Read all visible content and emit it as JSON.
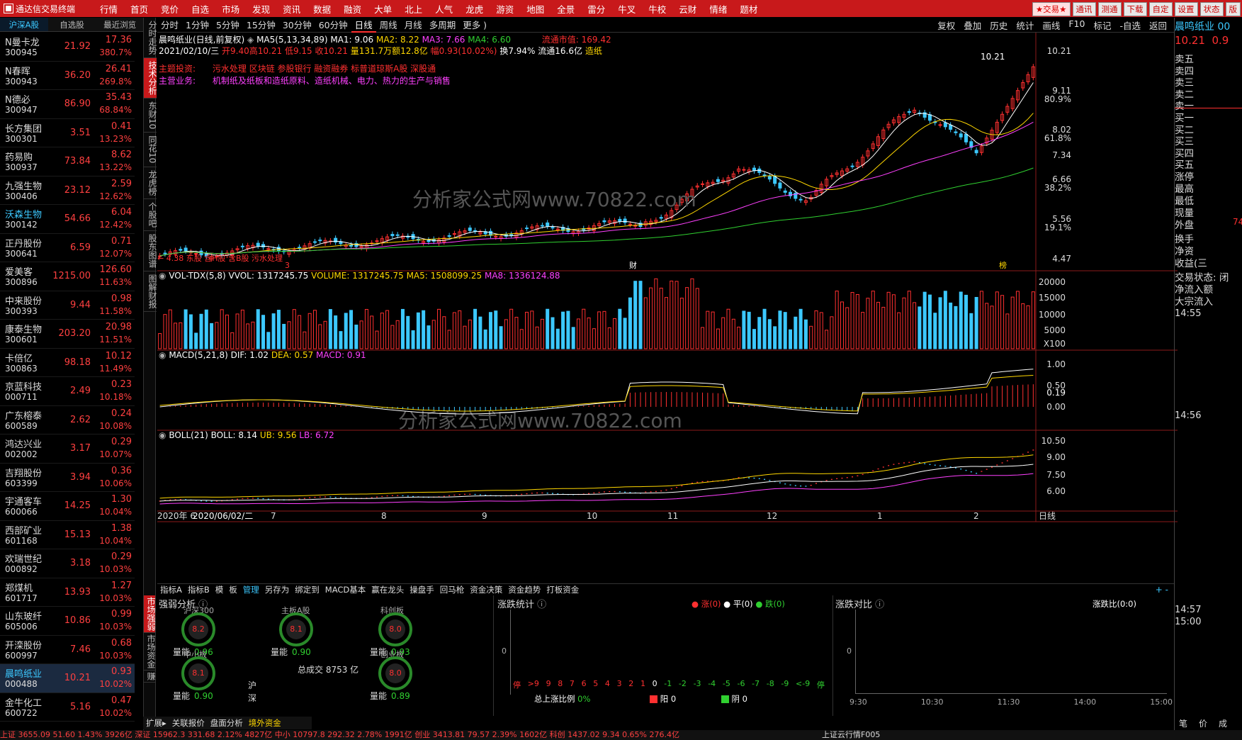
{
  "app": {
    "title": "通达信交易终端"
  },
  "menu": [
    "行情",
    "首页",
    "竞价",
    "自选",
    "市场",
    "发现",
    "资讯",
    "数据",
    "融资",
    "大单",
    "北上",
    "人气",
    "龙虎",
    "游资",
    "地图",
    "全景",
    "雷分",
    "牛叉",
    "牛校",
    "云财",
    "情绪",
    "题材"
  ],
  "menu_right": [
    "★交易★",
    "通讯",
    "测通",
    "下载",
    "自定",
    "设置",
    "状态",
    "版"
  ],
  "left_tabs": [
    "沪深A股",
    "自选股",
    "最近浏览"
  ],
  "stocks": [
    {
      "name": "N曼卡龙",
      "code": "300945",
      "price": "21.92",
      "chg": "17.36",
      "pct": "380.7%"
    },
    {
      "name": "N春晖",
      "code": "300943",
      "price": "36.20",
      "chg": "26.41",
      "pct": "269.8%"
    },
    {
      "name": "N德必",
      "code": "300947",
      "price": "86.90",
      "chg": "35.43",
      "pct": "68.84%"
    },
    {
      "name": "长方集团",
      "code": "300301",
      "price": "3.51",
      "chg": "0.41",
      "pct": "13.23%"
    },
    {
      "name": "药易购",
      "code": "300937",
      "price": "73.84",
      "chg": "8.62",
      "pct": "13.22%"
    },
    {
      "name": "九强生物",
      "code": "300406",
      "price": "23.12",
      "chg": "2.59",
      "pct": "12.62%"
    },
    {
      "name": "沃森生物",
      "code": "300142",
      "price": "54.66",
      "chg": "6.04",
      "pct": "12.42%"
    },
    {
      "name": "正丹股份",
      "code": "300641",
      "price": "6.59",
      "chg": "0.71",
      "pct": "12.07%"
    },
    {
      "name": "爱美客",
      "code": "300896",
      "price": "1215.00",
      "chg": "126.60",
      "pct": "11.63%"
    },
    {
      "name": "中来股份",
      "code": "300393",
      "price": "9.44",
      "chg": "0.98",
      "pct": "11.58%"
    },
    {
      "name": "康泰生物",
      "code": "300601",
      "price": "203.20",
      "chg": "20.98",
      "pct": "11.51%"
    },
    {
      "name": "卡倍亿",
      "code": "300863",
      "price": "98.18",
      "chg": "10.12",
      "pct": "11.49%"
    },
    {
      "name": "京蓝科技",
      "code": "000711",
      "price": "2.49",
      "chg": "0.23",
      "pct": "10.18%"
    },
    {
      "name": "广东榕泰",
      "code": "600589",
      "price": "2.62",
      "chg": "0.24",
      "pct": "10.08%"
    },
    {
      "name": "鸿达兴业",
      "code": "002002",
      "price": "3.17",
      "chg": "0.29",
      "pct": "10.07%"
    },
    {
      "name": "吉翔股份",
      "code": "603399",
      "price": "3.94",
      "chg": "0.36",
      "pct": "10.06%"
    },
    {
      "name": "宇通客车",
      "code": "600066",
      "price": "14.25",
      "chg": "1.30",
      "pct": "10.04%"
    },
    {
      "name": "西部矿业",
      "code": "601168",
      "price": "15.13",
      "chg": "1.38",
      "pct": "10.04%"
    },
    {
      "name": "欢瑞世纪",
      "code": "000892",
      "price": "3.18",
      "chg": "0.29",
      "pct": "10.03%"
    },
    {
      "name": "郑煤机",
      "code": "601717",
      "price": "13.93",
      "chg": "1.27",
      "pct": "10.03%"
    },
    {
      "name": "山东玻纤",
      "code": "605006",
      "price": "10.86",
      "chg": "0.99",
      "pct": "10.03%"
    },
    {
      "name": "开滦股份",
      "code": "600997",
      "price": "7.46",
      "chg": "0.68",
      "pct": "10.03%"
    },
    {
      "name": "晨鸣纸业",
      "code": "000488",
      "price": "10.21",
      "chg": "0.93",
      "pct": "10.02%"
    },
    {
      "name": "金牛化工",
      "code": "600722",
      "price": "5.16",
      "chg": "0.47",
      "pct": "10.02%"
    }
  ],
  "vtabs": [
    "分时走势",
    "技术分析",
    "东财10",
    "同花10",
    "龙虎榜",
    "个股吧",
    "股东图谱",
    "图解财报"
  ],
  "periods": [
    "分时",
    "1分钟",
    "5分钟",
    "15分钟",
    "30分钟",
    "60分钟",
    "日线",
    "周线",
    "月线",
    "多周期",
    "更多 )"
  ],
  "tools": [
    "复权",
    "叠加",
    "历史",
    "统计",
    "画线",
    "F10",
    "标记",
    "-自选",
    "返回"
  ],
  "info": {
    "name": "晨鸣纸业(日线,前复权)",
    "ma5": "MA5(5,13,34,89)",
    "ma1": "MA1: 9.06",
    "ma2": "MA2: 8.22",
    "ma3": "MA3: 7.66",
    "ma4": "MA4: 6.60",
    "float_cap": "流通市值: 169.42",
    "date": "2021/02/10/三",
    "open": "开9.40",
    "high": "高10.21",
    "low": "低9.15",
    "close": "收10.21",
    "vol": "量131.7万",
    "amt": "额12.8亿",
    "range": "幅0.93(10.02%)",
    "turn": "换7.94%",
    "flow": "流通16.6亿",
    "industry": "造纸",
    "theme_label": "主题投资:",
    "themes": "污水处理   区块链   参股银行   融资融券   标普道琼斯A股   深股通",
    "biz_label": "主营业务:",
    "biz": "机制纸及纸板和造纸原料、造纸机械、电力、热力的生产与销售",
    "low_mark": "← 4.38 东股  含H股 含B股 污水处理",
    "cai": "财",
    "bang": "榜",
    "three": "3",
    "high_mark": "10.21"
  },
  "price_axis": [
    "10.21",
    "9.11",
    "80.9%",
    "8.02",
    "61.8%",
    "7.34",
    "6.66",
    "38.2%",
    "5.56",
    "19.1%",
    "4.47"
  ],
  "vol_hdr": {
    "name": "VOL-TDX(5,8)",
    "vvol": "VVOL: 1317245.75",
    "volume": "VOLUME: 1317245.75",
    "ma5": "MA5: 1508099.25",
    "ma8": "MA8: 1336124.88"
  },
  "vol_axis": [
    "20000",
    "15000",
    "10000",
    "5000",
    "X100"
  ],
  "macd_hdr": {
    "name": "MACD(5,21,8)",
    "dif": "DIF: 1.02",
    "dea": "DEA: 0.57",
    "macd": "MACD: 0.91"
  },
  "macd_axis": [
    "1.00",
    "0.50",
    "0.19",
    "0.00"
  ],
  "boll_hdr": {
    "name": "BOLL(21)",
    "boll": "BOLL: 8.14",
    "ub": "UB: 9.56",
    "lb": "LB: 6.72"
  },
  "boll_axis": [
    "10.50",
    "9.00",
    "7.50",
    "6.00"
  ],
  "x_axis": {
    "start": "2020年 6",
    "date": "2020/06/02/二",
    "months": [
      "7",
      "8",
      "9",
      "10",
      "11",
      "12",
      "1",
      "2"
    ],
    "period": "日线"
  },
  "watermark": "分析家公式网www.70822.com",
  "bottom_tabs": [
    "指标A",
    "指标B",
    "模",
    "板",
    "管理",
    "另存为",
    "绑定到",
    "MACD基本",
    "赢在龙头",
    "操盘手",
    "回马枪",
    "资金决策",
    "资金趋势",
    "打板资金"
  ],
  "right_panel": {
    "name": "晨鸣纸业",
    "code": "00",
    "price": "10.21",
    "price2": "0.9",
    "sell": [
      "卖五",
      "卖四",
      "卖三",
      "卖二",
      "卖一"
    ],
    "buy": [
      "买一",
      "买二",
      "买三",
      "买四",
      "买五"
    ],
    "fields": [
      "涨停",
      "最高",
      "最低",
      "现量",
      "外盘",
      "换手",
      "净资",
      "收益(三"
    ],
    "outer_val": "74",
    "extra": [
      "交易状态: 闭",
      "净流入额",
      "大宗流入"
    ],
    "times": [
      "14:55",
      "14:56",
      "14:57",
      "15:00"
    ],
    "bottom": [
      "笔",
      "价",
      "成"
    ]
  },
  "strength": {
    "title": "强弱分析",
    "labels": [
      "沪深300",
      "主板A股",
      "科创板",
      "中小板",
      "创业板"
    ],
    "values": [
      "8.2",
      "8.1",
      "8.0",
      "8.1",
      "8.0"
    ],
    "vol_label": "量能",
    "vol_vals": [
      "0.96",
      "0.90",
      "0.93",
      "0.90",
      "0.89"
    ],
    "total": "总成交 8753 亿",
    "sh": "沪",
    "sz": "深"
  },
  "updown": {
    "title": "涨跌统计",
    "legend": [
      "涨(0)",
      "平(0)",
      "跌(0)"
    ],
    "zero": "0",
    "buckets": [
      "停",
      ">9",
      "9",
      "8",
      "7",
      "6",
      "5",
      "4",
      "3",
      "2",
      "1",
      "0",
      "-1",
      "-2",
      "-3",
      "-4",
      "-5",
      "-6",
      "-7",
      "-8",
      "-9",
      "<-9",
      "停"
    ],
    "ratio_label": "总上涨比例",
    "ratio": "0%",
    "yang": "阳 0",
    "yin": "阴 0"
  },
  "compare": {
    "title": "涨跌对比",
    "ratio": "涨跌比(0:0)",
    "zero": "0",
    "times": [
      "9:30",
      "10:30",
      "11:30",
      "14:00",
      "15:00"
    ]
  },
  "left_vtabs": [
    "市场强弱",
    "市场资金",
    "赚"
  ],
  "bottom_left": [
    "扩展▸",
    "关联报价",
    "盘面分析",
    "境外资金"
  ],
  "statusbar": "上证 3655.09  51.60  1.43%  3926亿  深证 15962.3  331.68  2.12%  4827亿  中小 10797.8  292.32  2.78%  1991亿  创业 3413.81  79.57  2.39%  1602亿  科创 1437.02  9.34  0.65%  276.4亿",
  "statusbar_right": "上证云行情F005",
  "chart_data": {
    "type": "line",
    "title": "晨鸣纸业(日线,前复权)",
    "series": [
      {
        "name": "MA1",
        "values": [
          4.6,
          4.7,
          4.9,
          5.1,
          5.3,
          5.2,
          5.5,
          5.4,
          5.3,
          5.5,
          5.4,
          5.5,
          5.4,
          5.5,
          5.5,
          5.4,
          5.5,
          6.3,
          7.2,
          6.8,
          6.5,
          6.4,
          6.6,
          7.8,
          8.3,
          8.1,
          8.0,
          9.0,
          9.06
        ]
      },
      {
        "name": "MA2",
        "values": [
          4.5,
          4.6,
          4.8,
          5.0,
          5.2,
          5.2,
          5.4,
          5.4,
          5.3,
          5.4,
          5.4,
          5.5,
          5.4,
          5.4,
          5.5,
          5.4,
          5.5,
          6.0,
          6.9,
          6.9,
          6.6,
          6.5,
          6.6,
          7.3,
          7.9,
          8.0,
          7.9,
          8.2,
          8.22
        ]
      },
      {
        "name": "MA3",
        "values": [
          4.4,
          4.5,
          4.6,
          4.8,
          4.9,
          5.0,
          5.1,
          5.2,
          5.2,
          5.3,
          5.3,
          5.3,
          5.3,
          5.3,
          5.4,
          5.4,
          5.4,
          5.6,
          6.0,
          6.2,
          6.3,
          6.4,
          6.5,
          6.8,
          7.1,
          7.3,
          7.4,
          7.6,
          7.66
        ]
      },
      {
        "name": "MA4",
        "values": [
          4.4,
          4.4,
          4.5,
          4.6,
          4.7,
          4.8,
          4.9,
          5.0,
          5.0,
          5.1,
          5.1,
          5.2,
          5.2,
          5.2,
          5.3,
          5.3,
          5.3,
          5.4,
          5.6,
          5.8,
          5.9,
          6.0,
          6.1,
          6.2,
          6.3,
          6.4,
          6.5,
          6.6,
          6.6
        ]
      }
    ],
    "ylim": [
      4.38,
      10.21
    ]
  }
}
